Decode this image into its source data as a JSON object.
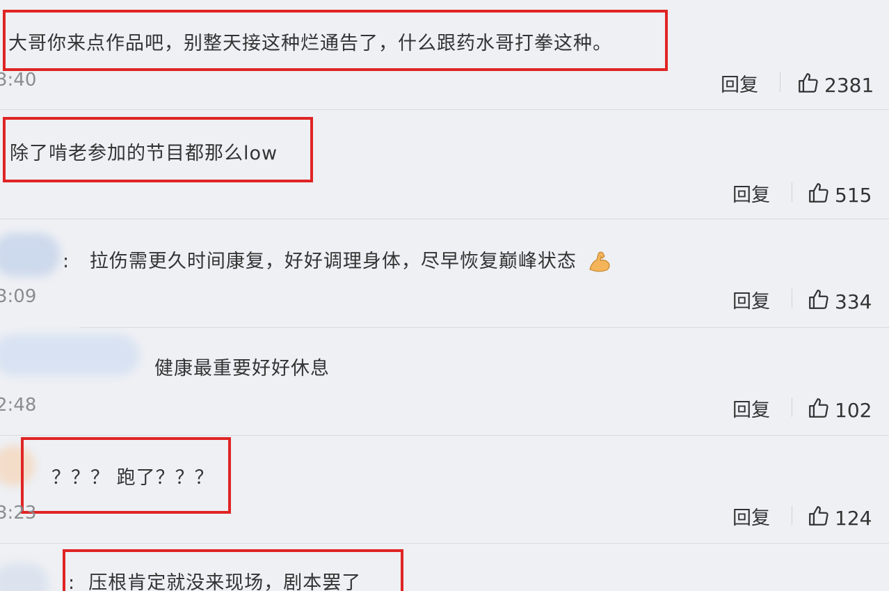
{
  "comments": [
    {
      "text": "大哥你来点作品吧，别整天接这种烂通告了，什么跟药水哥打拳这种。",
      "time": "3:40",
      "reply": "回复",
      "likes": "2381"
    },
    {
      "text": "除了啃老参加的节目都那么low",
      "time": "",
      "reply": "回复",
      "likes": "515"
    },
    {
      "text": "拉伤需更久时间康复，好好调理身体，尽早恢复巅峰状态",
      "time": "3:09",
      "reply": "回复",
      "likes": "334",
      "emoji": "flexed-biceps"
    },
    {
      "text": "健康最重要好好休息",
      "time": "2:48",
      "reply": "回复",
      "likes": "102"
    },
    {
      "text": "？？？ 跑了？？？",
      "time": "3:23",
      "reply": "回复",
      "likes": "124"
    },
    {
      "text": "压根肯定就没来现场，剧本罢了",
      "time": "",
      "reply": "",
      "likes": ""
    }
  ],
  "colors": {
    "highlight": "#e02424",
    "background": "#eef0f4"
  },
  "icons": {
    "like": "thumbs-up-icon"
  }
}
